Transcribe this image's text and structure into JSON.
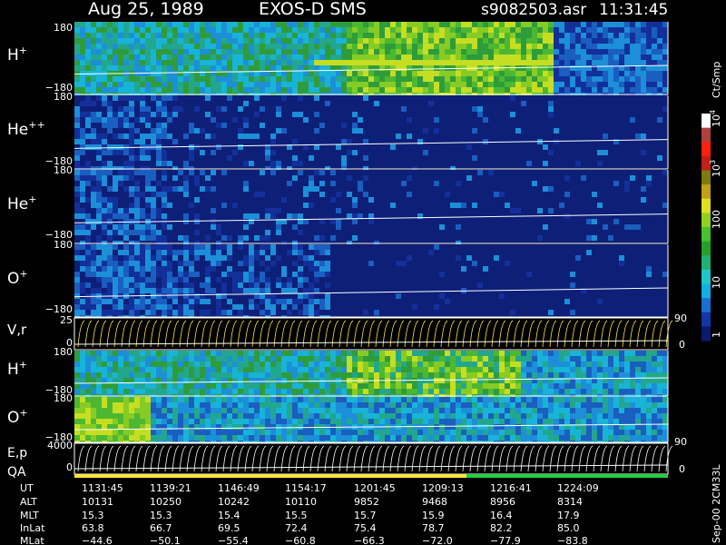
{
  "header": {
    "date": "Aug 25, 1989",
    "instrument": "EXOS-D SMS",
    "file": "s9082503.asr",
    "time": "11:31:45"
  },
  "colorbar": {
    "unit": "Ct/Smp",
    "tick_labels": [
      "1",
      "10",
      "100",
      "10",
      "10"
    ],
    "tick_exponents": [
      "",
      "",
      "",
      "3",
      "4"
    ],
    "tick_values": [
      1,
      10,
      100,
      1000,
      10000
    ],
    "colors": [
      "#0a1a6e",
      "#1236a8",
      "#1a6fd0",
      "#14aee0",
      "#1fc8c8",
      "#20b070",
      "#28a028",
      "#48c030",
      "#90d020",
      "#e0e020",
      "#c0a018",
      "#807a10",
      "#c02018",
      "#ff2010",
      "#b04040",
      "#ffffff"
    ]
  },
  "panels": {
    "h": {
      "base": "H",
      "sup": "+",
      "y_max": "180",
      "y_min": "−180"
    },
    "hepp": {
      "base": "He",
      "sup": "++",
      "y_max": "180",
      "y_min": "−180"
    },
    "hep": {
      "base": "He",
      "sup": "+",
      "y_max": "180",
      "y_min": "−180"
    },
    "o": {
      "base": "O",
      "sup": "+",
      "y_max": "180",
      "y_min": "−180"
    },
    "vr": {
      "label": "V,r",
      "y_max": "25",
      "y_min": "0",
      "r_max": "90",
      "r_min": "0"
    },
    "h2": {
      "base": "H",
      "sup": "+",
      "y_max": "180",
      "y_min": "−180"
    },
    "o2": {
      "base": "O",
      "sup": "+",
      "y_max": "180",
      "y_min": "−180"
    },
    "ep": {
      "label": "E,p",
      "qa": "QA",
      "y_max": "4000",
      "y_min": "0",
      "r_max": "90",
      "r_min": "0"
    }
  },
  "footer_date": "Sep-00 2CM33L",
  "chart_data": {
    "type": "heatmap",
    "title": "Aug 25, 1989   EXOS-D SMS",
    "panels": [
      "H+",
      "He++",
      "He+",
      "O+",
      "V,r",
      "H+",
      "O+",
      "E,p"
    ],
    "angle_range": [
      -180,
      180
    ],
    "velocity_range": [
      0,
      25
    ],
    "energy_range": [
      0,
      4000
    ],
    "r_axis_range": [
      0,
      90
    ],
    "colorbar_range": [
      1,
      10000
    ],
    "colorbar_scale": "log",
    "ephemeris": {
      "labels": [
        "UT",
        "ALT",
        "MLT",
        "InLat",
        "MLat"
      ],
      "columns": [
        {
          "UT": "1131:45",
          "ALT": "10131",
          "MLT": "15.3",
          "InLat": "63.8",
          "MLat": "−44.6"
        },
        {
          "UT": "1139:21",
          "ALT": "10250",
          "MLT": "15.3",
          "InLat": "66.7",
          "MLat": "−50.1"
        },
        {
          "UT": "1146:49",
          "ALT": "10242",
          "MLT": "15.4",
          "InLat": "69.5",
          "MLat": "−55.4"
        },
        {
          "UT": "1154:17",
          "ALT": "10110",
          "MLT": "15.5",
          "InLat": "72.4",
          "MLat": "−60.8"
        },
        {
          "UT": "1201:45",
          "ALT": "9852",
          "MLT": "15.7",
          "InLat": "75.4",
          "MLat": "−66.3"
        },
        {
          "UT": "1209:13",
          "ALT": "9468",
          "MLT": "15.9",
          "InLat": "78.7",
          "MLat": "−72.0"
        },
        {
          "UT": "1216:41",
          "ALT": "8956",
          "MLT": "16.4",
          "InLat": "82.2",
          "MLat": "−77.9"
        },
        {
          "UT": "1224:09",
          "ALT": "8314",
          "MLT": "17.9",
          "InLat": "85.0",
          "MLat": "−83.8"
        }
      ]
    }
  }
}
